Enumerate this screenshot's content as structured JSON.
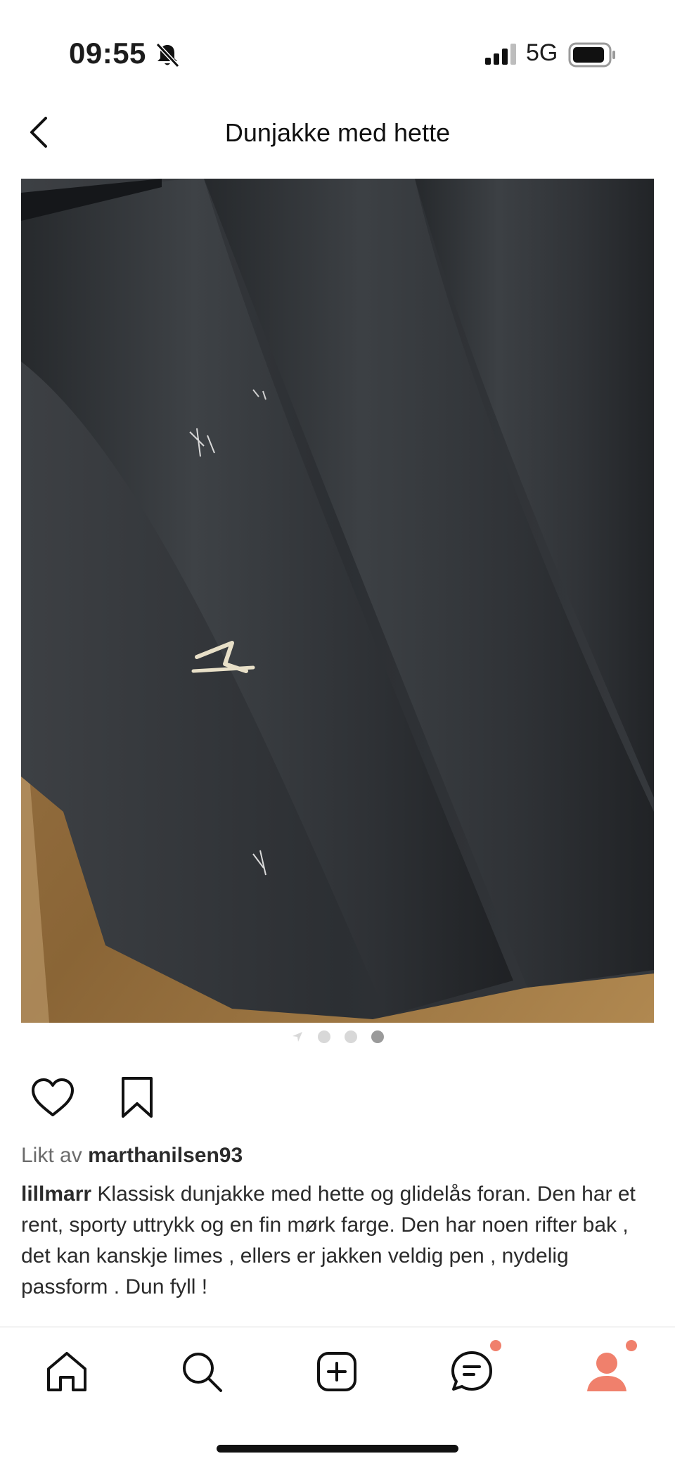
{
  "status_bar": {
    "time": "09:55",
    "network": "5G",
    "icons": [
      "bell-slash-icon",
      "signal-icon",
      "battery-icon"
    ]
  },
  "header": {
    "title": "Dunjakke med hette",
    "back_icon": "chevron-left-icon"
  },
  "carousel": {
    "total_slides": 4,
    "active_index": 3,
    "image_alt": "Dunjakke"
  },
  "actions": {
    "like_icon": "heart-icon",
    "save_icon": "bookmark-icon"
  },
  "likes": {
    "prefix": "Likt av",
    "user": "marthanilsen93"
  },
  "caption": {
    "user": "lillmarr",
    "text": "Klassisk dunjakke med hette og glidelås foran. Den har et rent, sporty uttrykk og en fin mørk farge. Den har noen rifter bak , det kan kanskje limes , ellers er jakken veldig pen , nydelig passform .  Dun fyll !"
  },
  "bottom_nav": {
    "items": [
      {
        "name": "home",
        "icon": "home-icon"
      },
      {
        "name": "search",
        "icon": "search-icon"
      },
      {
        "name": "create",
        "icon": "plus-square-icon"
      },
      {
        "name": "messages",
        "icon": "chat-icon",
        "badge": true
      },
      {
        "name": "profile",
        "icon": "profile-icon",
        "badge": true
      }
    ]
  },
  "colors": {
    "accent": "#f0806c",
    "text": "#2b2b2b",
    "muted": "#6b6b6b"
  }
}
